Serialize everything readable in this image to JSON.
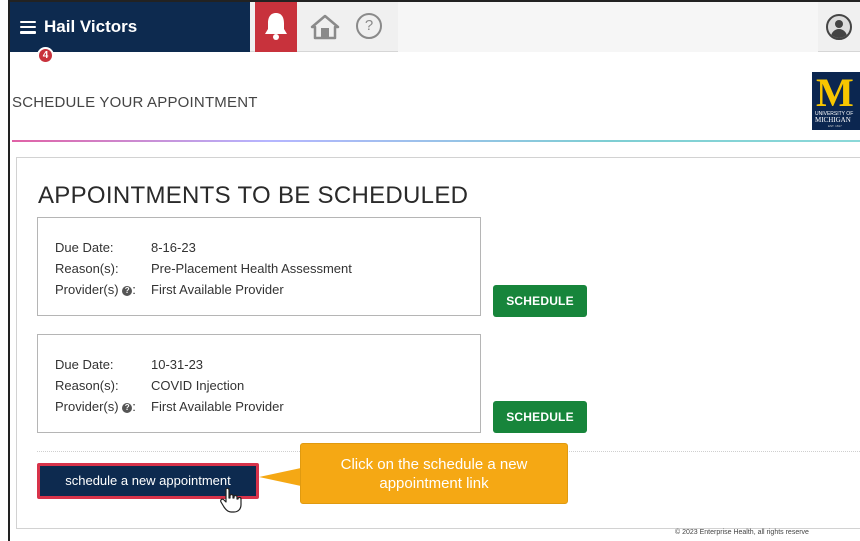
{
  "app": {
    "title": "Hail Victors",
    "notification_count": "4",
    "help_glyph": "?"
  },
  "page": {
    "title": "SCHEDULE YOUR APPOINTMENT"
  },
  "logo": {
    "letter": "M",
    "line1": "UNIVERSITY OF",
    "line2": "MICHIGAN",
    "line3": "EST. 1817"
  },
  "section": {
    "title": "APPOINTMENTS TO BE SCHEDULED"
  },
  "labels": {
    "due_date": "Due Date:",
    "reasons": "Reason(s):",
    "providers": "Provider(s)",
    "providers_suffix": ":"
  },
  "appointments": [
    {
      "due_date": "8-16-23",
      "reason": "Pre-Placement Health Assessment",
      "provider": "First Available Provider",
      "action_label": "SCHEDULE"
    },
    {
      "due_date": "10-31-23",
      "reason": "COVID Injection",
      "provider": "First Available Provider",
      "action_label": "SCHEDULE"
    }
  ],
  "new_appointment": {
    "label": "schedule a new appointment"
  },
  "callout": {
    "line1": "Click on the schedule a new",
    "line2": "appointment link"
  },
  "footer": {
    "text": "© 2023 Enterprise Health, all rights reserve"
  },
  "colors": {
    "brand_navy": "#0d2a4f",
    "notification_red": "#c8323c",
    "schedule_green": "#17853b",
    "callout_orange": "#f5a814",
    "highlight_red": "#d8334a",
    "logo_maize": "#f7c600"
  },
  "icons": {
    "menu": "hamburger-icon",
    "notifications": "bell-icon",
    "home": "home-icon",
    "help": "help-icon",
    "user": "user-icon",
    "provider_help": "question-circle-icon",
    "cursor": "hand-pointer-icon"
  }
}
